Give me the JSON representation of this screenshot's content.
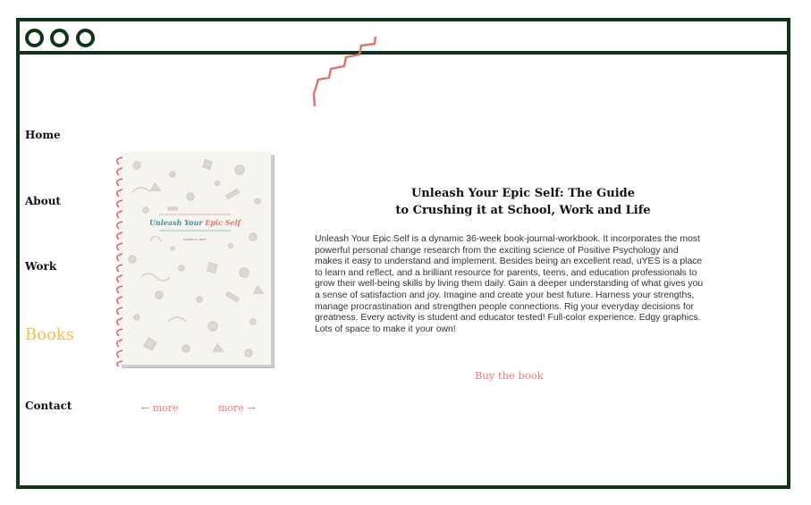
{
  "theme": {
    "frame": "#0f3518",
    "accent_yellow": "#f2c14a",
    "accent_coral": "#ef7a74",
    "cover_blue": "#4f8ea2"
  },
  "window": {
    "controls": [
      "circle-icon",
      "circle-icon",
      "circle-icon"
    ]
  },
  "nav": {
    "items": [
      {
        "label": "Home",
        "active": false
      },
      {
        "label": "About",
        "active": false
      },
      {
        "label": "Work",
        "active": false
      },
      {
        "label": "Books",
        "active": true
      },
      {
        "label": "Contact",
        "active": false
      }
    ]
  },
  "book": {
    "cover": {
      "title_part1": "Unleash Your ",
      "title_part2": "Epic Self",
      "subtitle": "SAMPLE TEXT"
    },
    "title": "Unleash Your Epic Self: The Guide to Crushing it at School, Work and Life",
    "title_line1": "Unleash Your Epic Self: The Guide",
    "title_line2": "to Crushing it at School, Work and Life",
    "description": "Unleash Your Epic Self is a dynamic 36-week book-journal-workbook. It incorporates the most powerful personal change research from the exciting science of Positive Psychology and makes it easy to understand and implement. Besides being an excellent read, uYES is a place to learn and reflect, and a brilliant resource for parents, teens, and education professionals to grow their well-being skills by living them daily. Gain a deeper understanding of what gives you a sense of satisfaction and joy. Imagine and create your best future. Harness your strengths, manage procrastination and strengthen people connections. Rig your everyday decisions for greatness. Every activity is student and educator tested! Full-color experience. Edgy graphics. Lots of space to make it your own!",
    "buy_label": "Buy the book"
  },
  "pager": {
    "prev_label": "← more",
    "next_label": "more →"
  }
}
